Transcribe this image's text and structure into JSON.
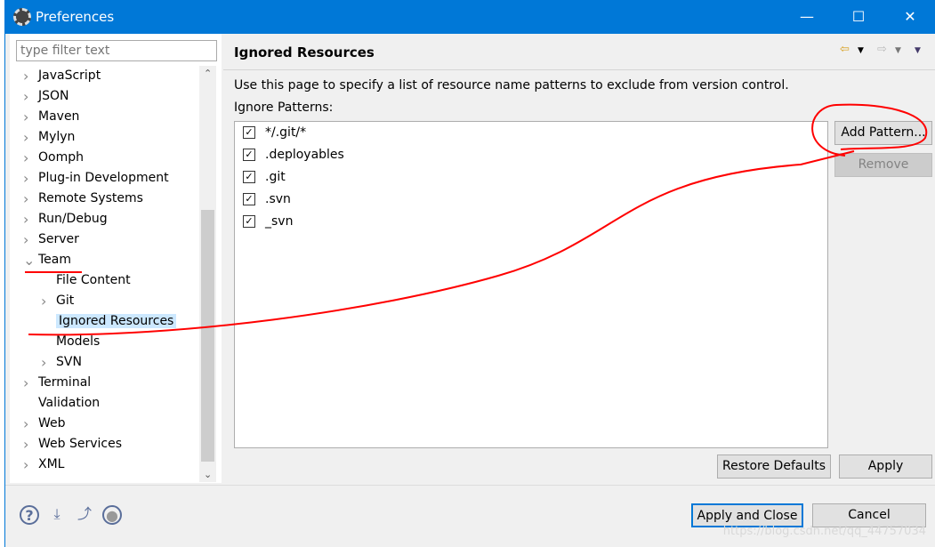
{
  "window": {
    "title": "Preferences",
    "minimize": "—",
    "maximize": "☐",
    "close": "✕"
  },
  "sidebar": {
    "filter_placeholder": "type filter text",
    "items": [
      {
        "label": "JavaScript",
        "level": 0,
        "expander": "collapsed"
      },
      {
        "label": "JSON",
        "level": 0,
        "expander": "collapsed"
      },
      {
        "label": "Maven",
        "level": 0,
        "expander": "collapsed"
      },
      {
        "label": "Mylyn",
        "level": 0,
        "expander": "collapsed"
      },
      {
        "label": "Oomph",
        "level": 0,
        "expander": "collapsed"
      },
      {
        "label": "Plug-in Development",
        "level": 0,
        "expander": "collapsed"
      },
      {
        "label": "Remote Systems",
        "level": 0,
        "expander": "collapsed"
      },
      {
        "label": "Run/Debug",
        "level": 0,
        "expander": "collapsed"
      },
      {
        "label": "Server",
        "level": 0,
        "expander": "collapsed"
      },
      {
        "label": "Team",
        "level": 0,
        "expander": "expanded"
      },
      {
        "label": "File Content",
        "level": 1,
        "expander": "none"
      },
      {
        "label": "Git",
        "level": 1,
        "expander": "collapsed"
      },
      {
        "label": "Ignored Resources",
        "level": 1,
        "expander": "none",
        "selected": true
      },
      {
        "label": "Models",
        "level": 1,
        "expander": "none"
      },
      {
        "label": "SVN",
        "level": 1,
        "expander": "collapsed"
      },
      {
        "label": "Terminal",
        "level": 0,
        "expander": "collapsed"
      },
      {
        "label": "Validation",
        "level": 0,
        "expander": "none"
      },
      {
        "label": "Web",
        "level": 0,
        "expander": "collapsed"
      },
      {
        "label": "Web Services",
        "level": 0,
        "expander": "collapsed"
      },
      {
        "label": "XML",
        "level": 0,
        "expander": "collapsed"
      }
    ]
  },
  "page": {
    "title": "Ignored Resources",
    "description": "Use this page to specify a list of resource name patterns to exclude from version control.",
    "patterns_label": "Ignore Patterns:",
    "patterns": [
      {
        "label": "*/.git/*",
        "checked": true
      },
      {
        "label": ".deployables",
        "checked": true
      },
      {
        "label": ".git",
        "checked": true
      },
      {
        "label": ".svn",
        "checked": true
      },
      {
        "label": "_svn",
        "checked": true
      }
    ],
    "add_pattern": "Add Pattern...",
    "remove": "Remove",
    "restore_defaults": "Restore Defaults",
    "apply": "Apply"
  },
  "footer": {
    "apply_and_close": "Apply and Close",
    "cancel": "Cancel"
  },
  "watermark": "https://blog.csdn.net/qq_44757034",
  "colors": {
    "accent": "#0078d7",
    "selection": "#cce8ff",
    "annotation": "#ff0000"
  }
}
